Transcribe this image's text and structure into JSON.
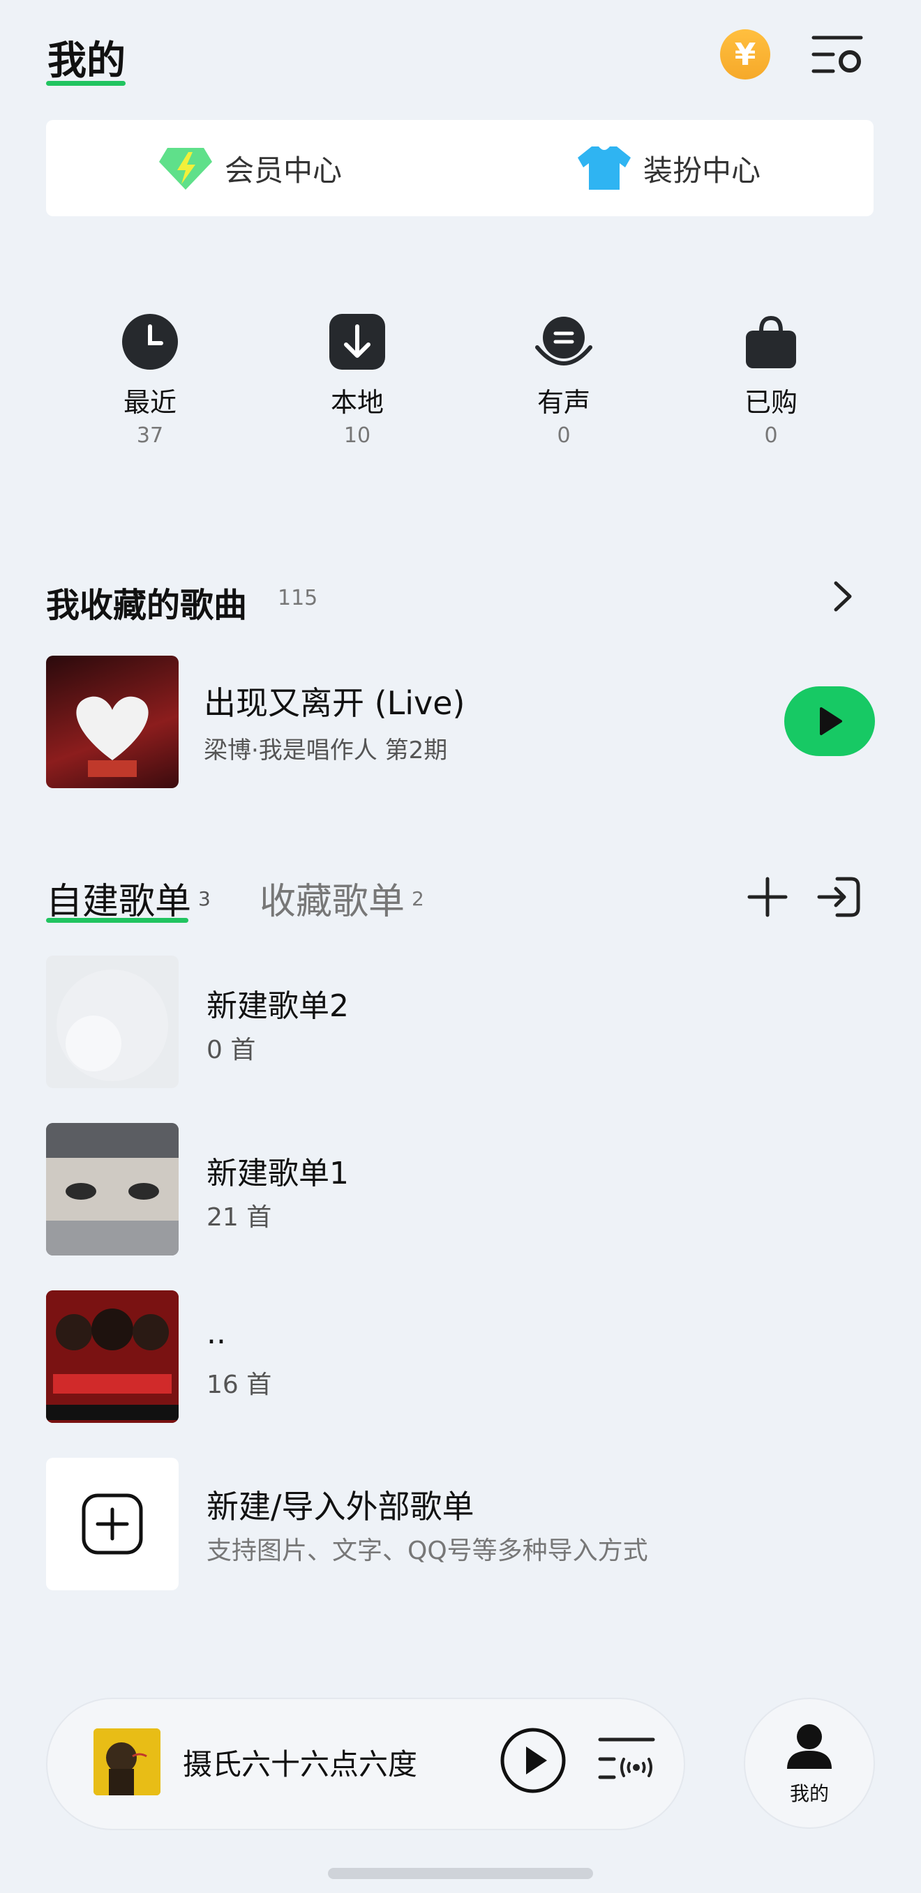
{
  "header": {
    "title": "我的"
  },
  "member": {
    "vip_label": "会员中心",
    "dress_label": "装扮中心"
  },
  "quick": [
    {
      "label": "最近",
      "count": "37",
      "icon": "clock-icon"
    },
    {
      "label": "本地",
      "count": "10",
      "icon": "download-icon"
    },
    {
      "label": "有声",
      "count": "0",
      "icon": "audiobook-icon"
    },
    {
      "label": "已购",
      "count": "0",
      "icon": "shopping-bag-icon"
    }
  ],
  "favorites": {
    "title": "我收藏的歌曲",
    "count": "115",
    "song": {
      "title": "出现又离开 (Live)",
      "subtitle": "梁博·我是唱作人 第2期"
    }
  },
  "playlists": {
    "tabs": [
      {
        "label": "自建歌单",
        "count": "3"
      },
      {
        "label": "收藏歌单",
        "count": "2"
      }
    ],
    "items": [
      {
        "name": "新建歌单2",
        "count": "0 首"
      },
      {
        "name": "新建歌单1",
        "count": "21 首"
      },
      {
        "name": "..",
        "count": "16 首"
      }
    ],
    "new_item": {
      "title": "新建/导入外部歌单",
      "subtitle": "支持图片、文字、QQ号等多种导入方式"
    }
  },
  "player": {
    "title": "摄氏六十六点六度"
  },
  "nav": {
    "me_label": "我的"
  },
  "colors": {
    "accent": "#17c964",
    "coin": "#f6a92a",
    "background": "#eef2f7"
  }
}
